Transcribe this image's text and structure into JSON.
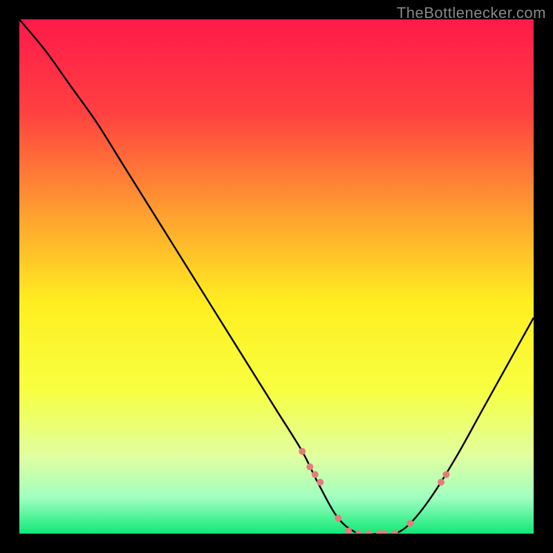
{
  "watermark": "TheBottlenecker.com",
  "chart_data": {
    "type": "line",
    "title": "",
    "xlabel": "",
    "ylabel": "",
    "xlim": [
      0,
      100
    ],
    "ylim": [
      0,
      100
    ],
    "background_gradient_stops": [
      {
        "offset": 0.0,
        "color": "#ff1a4a"
      },
      {
        "offset": 0.18,
        "color": "#ff4040"
      },
      {
        "offset": 0.38,
        "color": "#ffa030"
      },
      {
        "offset": 0.55,
        "color": "#ffee20"
      },
      {
        "offset": 0.72,
        "color": "#f7ff40"
      },
      {
        "offset": 0.85,
        "color": "#e0ffa0"
      },
      {
        "offset": 0.93,
        "color": "#a0ffc0"
      },
      {
        "offset": 1.0,
        "color": "#10e878"
      }
    ],
    "series": [
      {
        "name": "bottleneck-curve",
        "x": [
          0,
          5,
          10,
          15,
          20,
          25,
          30,
          35,
          40,
          45,
          50,
          55,
          58,
          62,
          66,
          70,
          73,
          76,
          80,
          85,
          90,
          95,
          100
        ],
        "y": [
          100,
          94,
          87,
          80,
          72,
          64,
          56,
          48,
          40,
          32,
          24,
          16,
          10,
          3,
          0,
          0,
          0,
          2,
          7,
          15,
          24,
          33,
          42
        ]
      }
    ],
    "markers": {
      "name": "highlighted-region",
      "x": [
        55,
        56.5,
        57.5,
        58.5,
        62,
        64,
        66,
        68,
        70,
        71,
        73,
        76,
        82,
        83
      ],
      "y": [
        16,
        13,
        11.5,
        10,
        3,
        0.5,
        0,
        0,
        0,
        0,
        0,
        2,
        10,
        11.5
      ],
      "color": "#e57c7c",
      "radius": 5
    }
  }
}
